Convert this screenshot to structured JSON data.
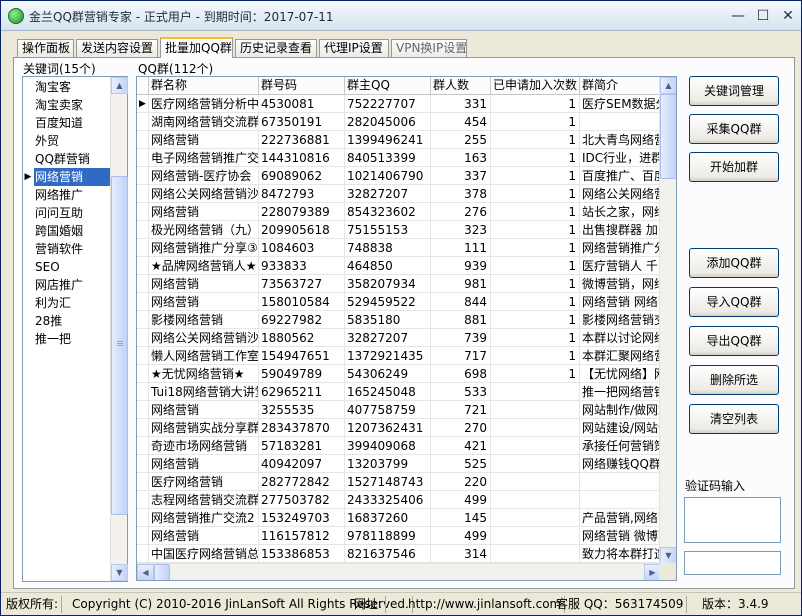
{
  "window": {
    "title": "金兰QQ群营销专家 - 正式用户 - 到期时间：2017-07-11",
    "minimize_glyph": "—",
    "maximize_glyph": "☐",
    "close_glyph": "✕"
  },
  "tabs": [
    {
      "label": "操作面板"
    },
    {
      "label": "发送内容设置"
    },
    {
      "label": "批量加QQ群"
    },
    {
      "label": "历史记录查看"
    },
    {
      "label": "代理IP设置"
    },
    {
      "label": "VPN换IP设置"
    }
  ],
  "keywords": {
    "label": "关键词(15个)",
    "selected_index": 5,
    "items": [
      "淘宝客",
      "淘宝卖家",
      "百度知道",
      "外贸",
      "QQ群营销",
      "网络营销",
      "网络推广",
      "问问互助",
      "跨国婚姻",
      "营销软件",
      "SEO",
      "网店推广",
      "利为汇",
      "28推",
      "推一把"
    ]
  },
  "qq_groups": {
    "label": "QQ群(112个)",
    "columns": [
      "群名称",
      "群号码",
      "群主QQ",
      "群人数",
      "已申请加入次数",
      "群简介"
    ],
    "rows": [
      [
        "医疗网络营销分析中",
        "4530081",
        "752227707",
        "331",
        "1",
        "医疗SEM数据分"
      ],
      [
        "湖南网络营销交流群",
        "67350191",
        "282045006",
        "454",
        "1",
        ""
      ],
      [
        "网络营销",
        "222736881",
        "1399496241",
        "255",
        "1",
        "北大青鸟网络营"
      ],
      [
        "电子网络营销推广交",
        "144310816",
        "840513399",
        "163",
        "1",
        "IDC行业，进群"
      ],
      [
        "网络营销-医疗协会",
        "69089062",
        "1021406790",
        "337",
        "1",
        "百度推广、百度"
      ],
      [
        "网络公关网络营销沙",
        "8472793",
        "32827207",
        "378",
        "1",
        "网络公关网络营"
      ],
      [
        "网络营销",
        "228079389",
        "854323602",
        "276",
        "1",
        "站长之家，网络"
      ],
      [
        "极光网络营销（九）",
        "209905618",
        "75155153",
        "323",
        "1",
        "出售搜群器 加"
      ],
      [
        "网络营销推广分享③",
        "1084603",
        "748838",
        "111",
        "1",
        "网络营销推广分"
      ],
      [
        "★品牌网络营销人★",
        "933833",
        "464850",
        "939",
        "1",
        "医疗营销人 千"
      ],
      [
        "网络营销",
        "73563727",
        "358207934",
        "981",
        "1",
        "微博营销，网络"
      ],
      [
        "网络营销",
        "158010584",
        "529459522",
        "844",
        "1",
        "网络营销 网络营"
      ],
      [
        "影楼网络营销",
        "69227982",
        "5835180",
        "881",
        "1",
        "影楼网络营销交"
      ],
      [
        "网络公关网络营销沙",
        "1880562",
        "32827207",
        "739",
        "1",
        "本群以讨论网络"
      ],
      [
        "懒人网络营销工作室",
        "154947651",
        "1372921435",
        "717",
        "1",
        "本群汇聚网络营"
      ],
      [
        "★无忧网络营销★",
        "59049789",
        "54306249",
        "698",
        "1",
        "【无忧网络】网"
      ],
      [
        " Tui18网络营销大讲堂",
        "62965211",
        "165245048",
        "533",
        "",
        "推一把网络营销"
      ],
      [
        "网络营销",
        "3255535",
        "407758759",
        "721",
        "",
        "网站制作/做网站"
      ],
      [
        "网络营销实战分享群",
        "283437870",
        "1207362431",
        "270",
        "",
        "网站建设/网站优"
      ],
      [
        "奇迹市场网络营销",
        "57183281",
        "399409068",
        "421",
        "",
        "承接任何营销策"
      ],
      [
        "网络营销",
        "40942097",
        "13203799",
        "525",
        "",
        "网络赚钱QQ群"
      ],
      [
        "医疗网络营销",
        "282772842",
        "1527148743",
        "220",
        "",
        ""
      ],
      [
        "志程网络营销交流群",
        "277503782",
        "2433325406",
        "499",
        "",
        ""
      ],
      [
        "网络营销推广交流2",
        "153249703",
        "16837260",
        "145",
        "",
        "产品营销,网络营"
      ],
      [
        "网络营销",
        "116157812",
        "978118899",
        "499",
        "",
        "网络营销 微博营"
      ],
      [
        "中国医疗网络营销总",
        "153386853",
        "821637546",
        "314",
        "",
        "致力将本群打造"
      ]
    ]
  },
  "buttons": {
    "keyword_manage": "关键词管理",
    "collect_groups": "采集QQ群",
    "start_join": "开始加群",
    "add_group": "添加QQ群",
    "import_group": "导入QQ群",
    "export_group": "导出QQ群",
    "delete_selected": "删除所选",
    "clear_list": "清空列表"
  },
  "captcha": {
    "label": "验证码输入",
    "value": ""
  },
  "statusbar": {
    "copyright_label": "版权所有:",
    "copyright_text": "Copyright (C) 2010-2016 JinLanSoft All Rights Reserved.",
    "url_label": "网址:",
    "url": "http://www.jinlansoft.com",
    "support_qq": "客服 QQ：563174509",
    "version": "版本：3.4.9"
  }
}
